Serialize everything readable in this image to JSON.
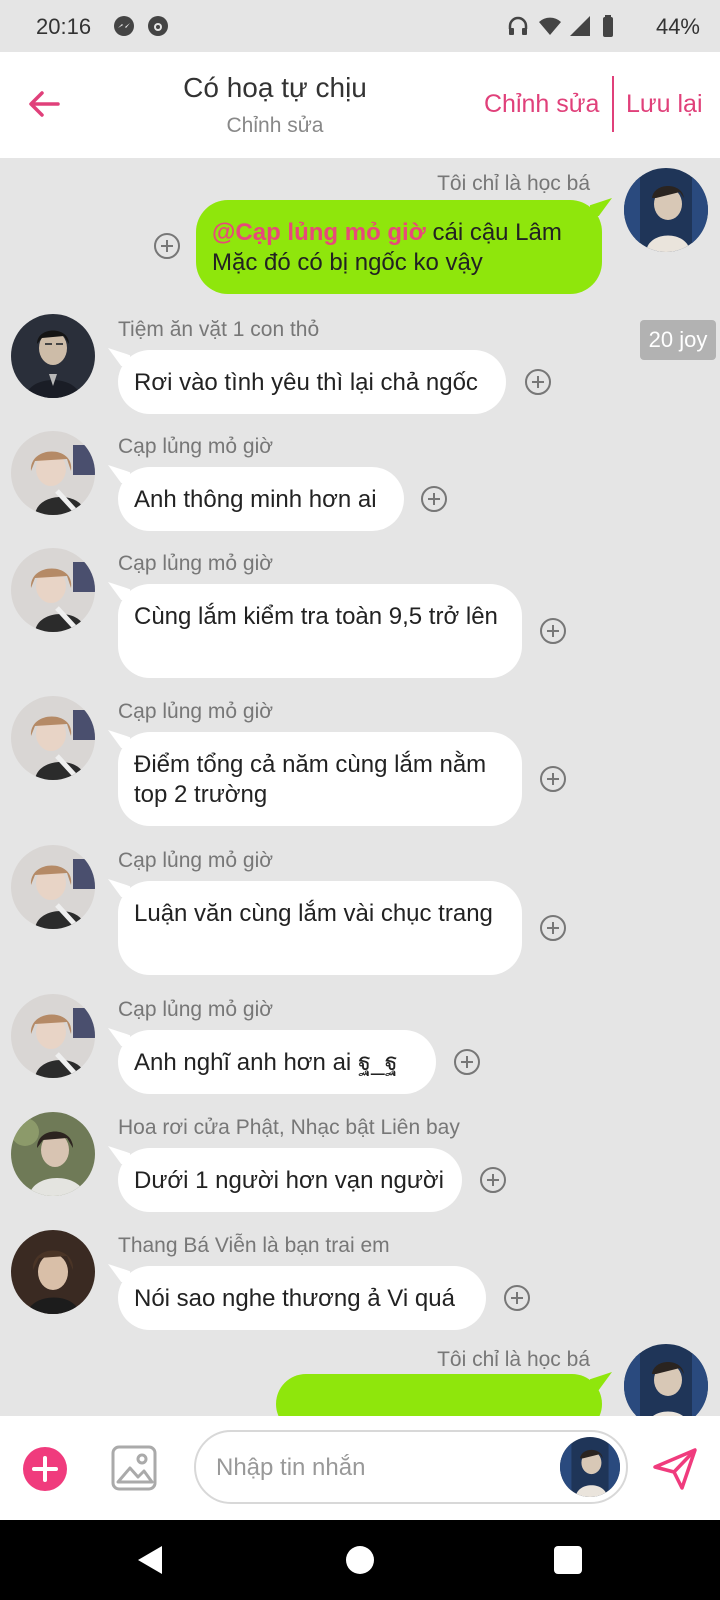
{
  "status": {
    "time": "20:16",
    "battery": "44%"
  },
  "header": {
    "title": "Có hoạ tự chịu",
    "subtitle": "Chỉnh sửa",
    "edit_label": "Chỉnh sửa",
    "save_label": "Lưu lại"
  },
  "badge": "20 joy",
  "messages": [
    {
      "sender": "Tôi chỉ là học bá",
      "mention": "@Cạp lủng mỏ giờ",
      "text": " cái cậu Lâm Mặc đó có bị ngốc ko vậy",
      "mine": true
    },
    {
      "sender": "Tiệm ăn vặt 1 con thỏ",
      "text": "Rơi vào tình yêu thì lại chả ngốc"
    },
    {
      "sender": "Cạp lủng mỏ giờ",
      "text": "Anh thông minh hơn ai"
    },
    {
      "sender": "Cạp lủng mỏ giờ",
      "text": "Cùng lắm kiểm tra toàn 9,5 trở lên"
    },
    {
      "sender": "Cạp lủng mỏ giờ",
      "text": "Điểm tổng cả năm cùng lắm nằm top 2 trường"
    },
    {
      "sender": "Cạp lủng mỏ giờ",
      "text": "Luận văn cùng lắm vài chục trang"
    },
    {
      "sender": "Cạp lủng mỏ giờ",
      "text": "Anh nghĩ anh hơn ai ฐ_ฐ"
    },
    {
      "sender": "Hoa rơi cửa Phật, Nhạc bật Liên bay",
      "text": "Dưới 1 người hơn vạn người"
    },
    {
      "sender": "Thang Bá Viễn là bạn trai em",
      "text": "Nói sao nghe thương ả Vi quá"
    },
    {
      "sender": "Tôi chỉ là học bá",
      "text": "",
      "mine": true
    }
  ],
  "composer": {
    "placeholder": "Nhập tin nhắn"
  },
  "colors": {
    "accent": "#e0407a",
    "my_bubble": "#8fe60c",
    "background": "#e5e5e5"
  },
  "icons": [
    "back-arrow-icon",
    "plus-circle-icon",
    "image-icon",
    "send-icon",
    "add-icon"
  ]
}
